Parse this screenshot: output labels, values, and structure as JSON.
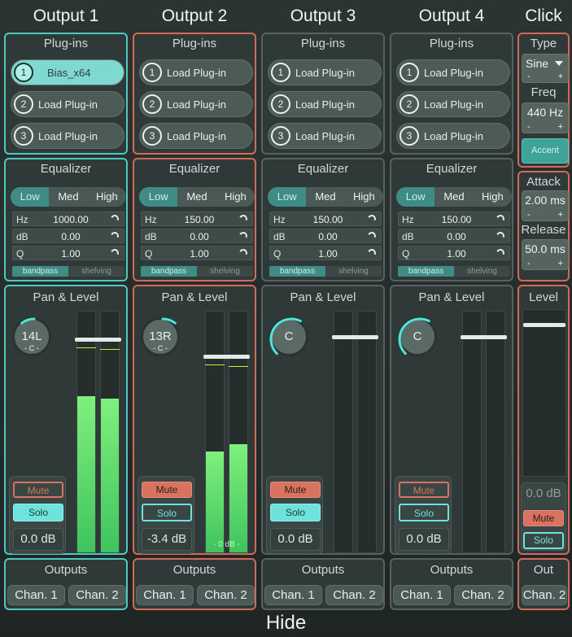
{
  "titles": [
    "Output 1",
    "Output 2",
    "Output 3",
    "Output 4",
    "Click"
  ],
  "strips": [
    {
      "plugin_title": "Plug-ins",
      "plugins": [
        {
          "num": "1",
          "label": "Bias_x64",
          "active": true
        },
        {
          "num": "2",
          "label": "Load Plug-in"
        },
        {
          "num": "3",
          "label": "Load Plug-in"
        }
      ],
      "eq": {
        "title": "Equalizer",
        "tabs": [
          "Low",
          "Med",
          "High"
        ],
        "selected": "Low",
        "hz": "1000.00",
        "db": "0.00",
        "q": "1.00",
        "bands": [
          "bandpass",
          "shelving"
        ]
      },
      "pan": {
        "title": "Pan & Level",
        "knob": "14L",
        "sub": "- C -",
        "pan_fraction": 0.36,
        "fader_fraction": 0.89,
        "meter_left": 0.65,
        "meter_right": 0.64,
        "mute": "Mute",
        "solo": "Solo",
        "mute_on": false,
        "solo_on": true,
        "level": "0.0 dB",
        "meter_label": ""
      },
      "outputs": {
        "title": "Outputs",
        "ch1": "Chan. 1",
        "ch2": "Chan. 2"
      }
    },
    {
      "plugin_title": "Plug-ins",
      "plugins": [
        {
          "num": "1",
          "label": "Load Plug-in"
        },
        {
          "num": "2",
          "label": "Load Plug-in"
        },
        {
          "num": "3",
          "label": "Load Plug-in"
        }
      ],
      "eq": {
        "title": "Equalizer",
        "tabs": [
          "Low",
          "Med",
          "High"
        ],
        "selected": "Low",
        "hz": "150.00",
        "db": "0.00",
        "q": "1.00",
        "bands": [
          "bandpass",
          "shelving"
        ]
      },
      "pan": {
        "title": "Pan & Level",
        "knob": "13R",
        "sub": "- C -",
        "pan_fraction": 0.64,
        "fader_fraction": 0.82,
        "meter_left": 0.42,
        "meter_right": 0.45,
        "mute": "Mute",
        "solo": "Solo",
        "mute_on": true,
        "solo_on": false,
        "level": "-3.4 dB",
        "meter_label": "- 0 dB -"
      },
      "outputs": {
        "title": "Outputs",
        "ch1": "Chan. 1",
        "ch2": "Chan. 2"
      }
    },
    {
      "plugin_title": "Plug-ins",
      "plugins": [
        {
          "num": "1",
          "label": "Load Plug-in"
        },
        {
          "num": "2",
          "label": "Load Plug-in"
        },
        {
          "num": "3",
          "label": "Load Plug-in"
        }
      ],
      "eq": {
        "title": "Equalizer",
        "tabs": [
          "Low",
          "Med",
          "High"
        ],
        "selected": "Low",
        "hz": "150.00",
        "db": "0.00",
        "q": "1.00",
        "bands": [
          "bandpass",
          "shelving"
        ]
      },
      "pan": {
        "title": "Pan & Level",
        "knob": "C",
        "sub": "",
        "pan_fraction": 0.5,
        "fader_fraction": 0.9,
        "meter_left": 0,
        "meter_right": 0,
        "mute": "Mute",
        "solo": "Solo",
        "mute_on": true,
        "solo_on": true,
        "level": "0.0 dB",
        "meter_label": ""
      },
      "outputs": {
        "title": "Outputs",
        "ch1": "Chan. 1",
        "ch2": "Chan. 2"
      }
    },
    {
      "plugin_title": "Plug-ins",
      "plugins": [
        {
          "num": "1",
          "label": "Load Plug-in"
        },
        {
          "num": "2",
          "label": "Load Plug-in"
        },
        {
          "num": "3",
          "label": "Load Plug-in"
        }
      ],
      "eq": {
        "title": "Equalizer",
        "tabs": [
          "Low",
          "Med",
          "High"
        ],
        "selected": "Low",
        "hz": "150.00",
        "db": "0.00",
        "q": "1.00",
        "bands": [
          "bandpass",
          "shelving"
        ]
      },
      "pan": {
        "title": "Pan & Level",
        "knob": "C",
        "sub": "",
        "pan_fraction": 0.5,
        "fader_fraction": 0.9,
        "meter_left": 0,
        "meter_right": 0,
        "mute": "Mute",
        "solo": "Solo",
        "mute_on": false,
        "solo_on": false,
        "level": "0.0 dB",
        "meter_label": ""
      },
      "outputs": {
        "title": "Outputs",
        "ch1": "Chan. 1",
        "ch2": "Chan. 2"
      }
    }
  ],
  "click": {
    "type_label": "Type",
    "type_value": "Sine",
    "freq_label": "Freq",
    "freq_value": "440 Hz",
    "accent": "Accent",
    "attack_label": "Attack",
    "attack_value": "2.00 ms",
    "release_label": "Release",
    "release_value": "50.0 ms",
    "minus": "-",
    "plus": "+",
    "level_title": "Level",
    "level_value": "0.0 dB",
    "fader_fraction": 0.92,
    "mute": "Mute",
    "solo": "Solo",
    "out_title": "Out",
    "out_ch": "Chan. 2"
  },
  "hide": "Hide",
  "colors": {
    "cyan": "#4ec9c2",
    "red": "#d16a5a",
    "meter": "#5be86a",
    "accent": "#3f8b86"
  }
}
